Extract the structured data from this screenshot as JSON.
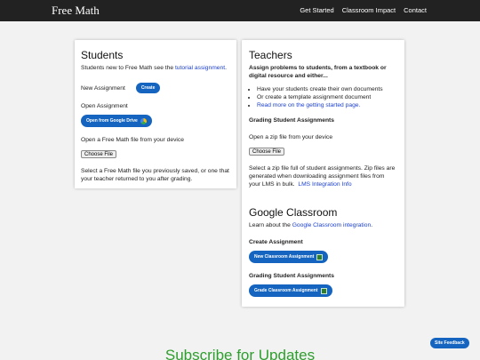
{
  "nav": {
    "brand": "Free Math",
    "links": [
      "Get Started",
      "Classroom Impact",
      "Contact"
    ]
  },
  "students": {
    "title": "Students",
    "intro": "Students new to Free Math see the ",
    "intro_link": "tutorial assignment",
    "intro_end": ".",
    "new_assignment_label": "New Assignment",
    "create_button": "Create",
    "open_assignment_label": "Open Assignment",
    "open_drive_button": "Open from Google Drive",
    "open_file_label": "Open a Free Math file from your device",
    "choose_file": "Choose File",
    "select_text": "Select a Free Math file you previously saved, or one that your teacher returned to you after grading."
  },
  "teachers": {
    "title": "Teachers",
    "subtitle": "Assign problems to students, from a textbook or digital resource and either...",
    "bullets": [
      "Have your students create their own documents",
      "Or create a template assignment document"
    ],
    "bullet_link": "Read more on the getting started page.",
    "grading_heading": "Grading Student Assignments",
    "zip_label": "Open a zip file from your device",
    "choose_file": "Choose File",
    "zip_text": "Select a zip file full of student assignments. Zip files are generated when downloading assignment files from your LMS in bulk.",
    "lms_link": "LMS Integration Info"
  },
  "classroom": {
    "title": "Google Classroom",
    "learn_text": "Learn about the ",
    "learn_link": "Google Classroom integration",
    "learn_end": ".",
    "create_heading": "Create Assignment",
    "new_button": "New Classroom Assignment",
    "grading_heading": "Grading Student Assignments",
    "grade_button": "Grade Classroom Assignment"
  },
  "footer": {
    "subscribe": "Subscribe for Updates",
    "feedback_button": "Site Feedback"
  },
  "colors": {
    "accent_blue": "#1565c0",
    "subscribe_green": "#2e9e2e",
    "navbar": "#222222"
  }
}
